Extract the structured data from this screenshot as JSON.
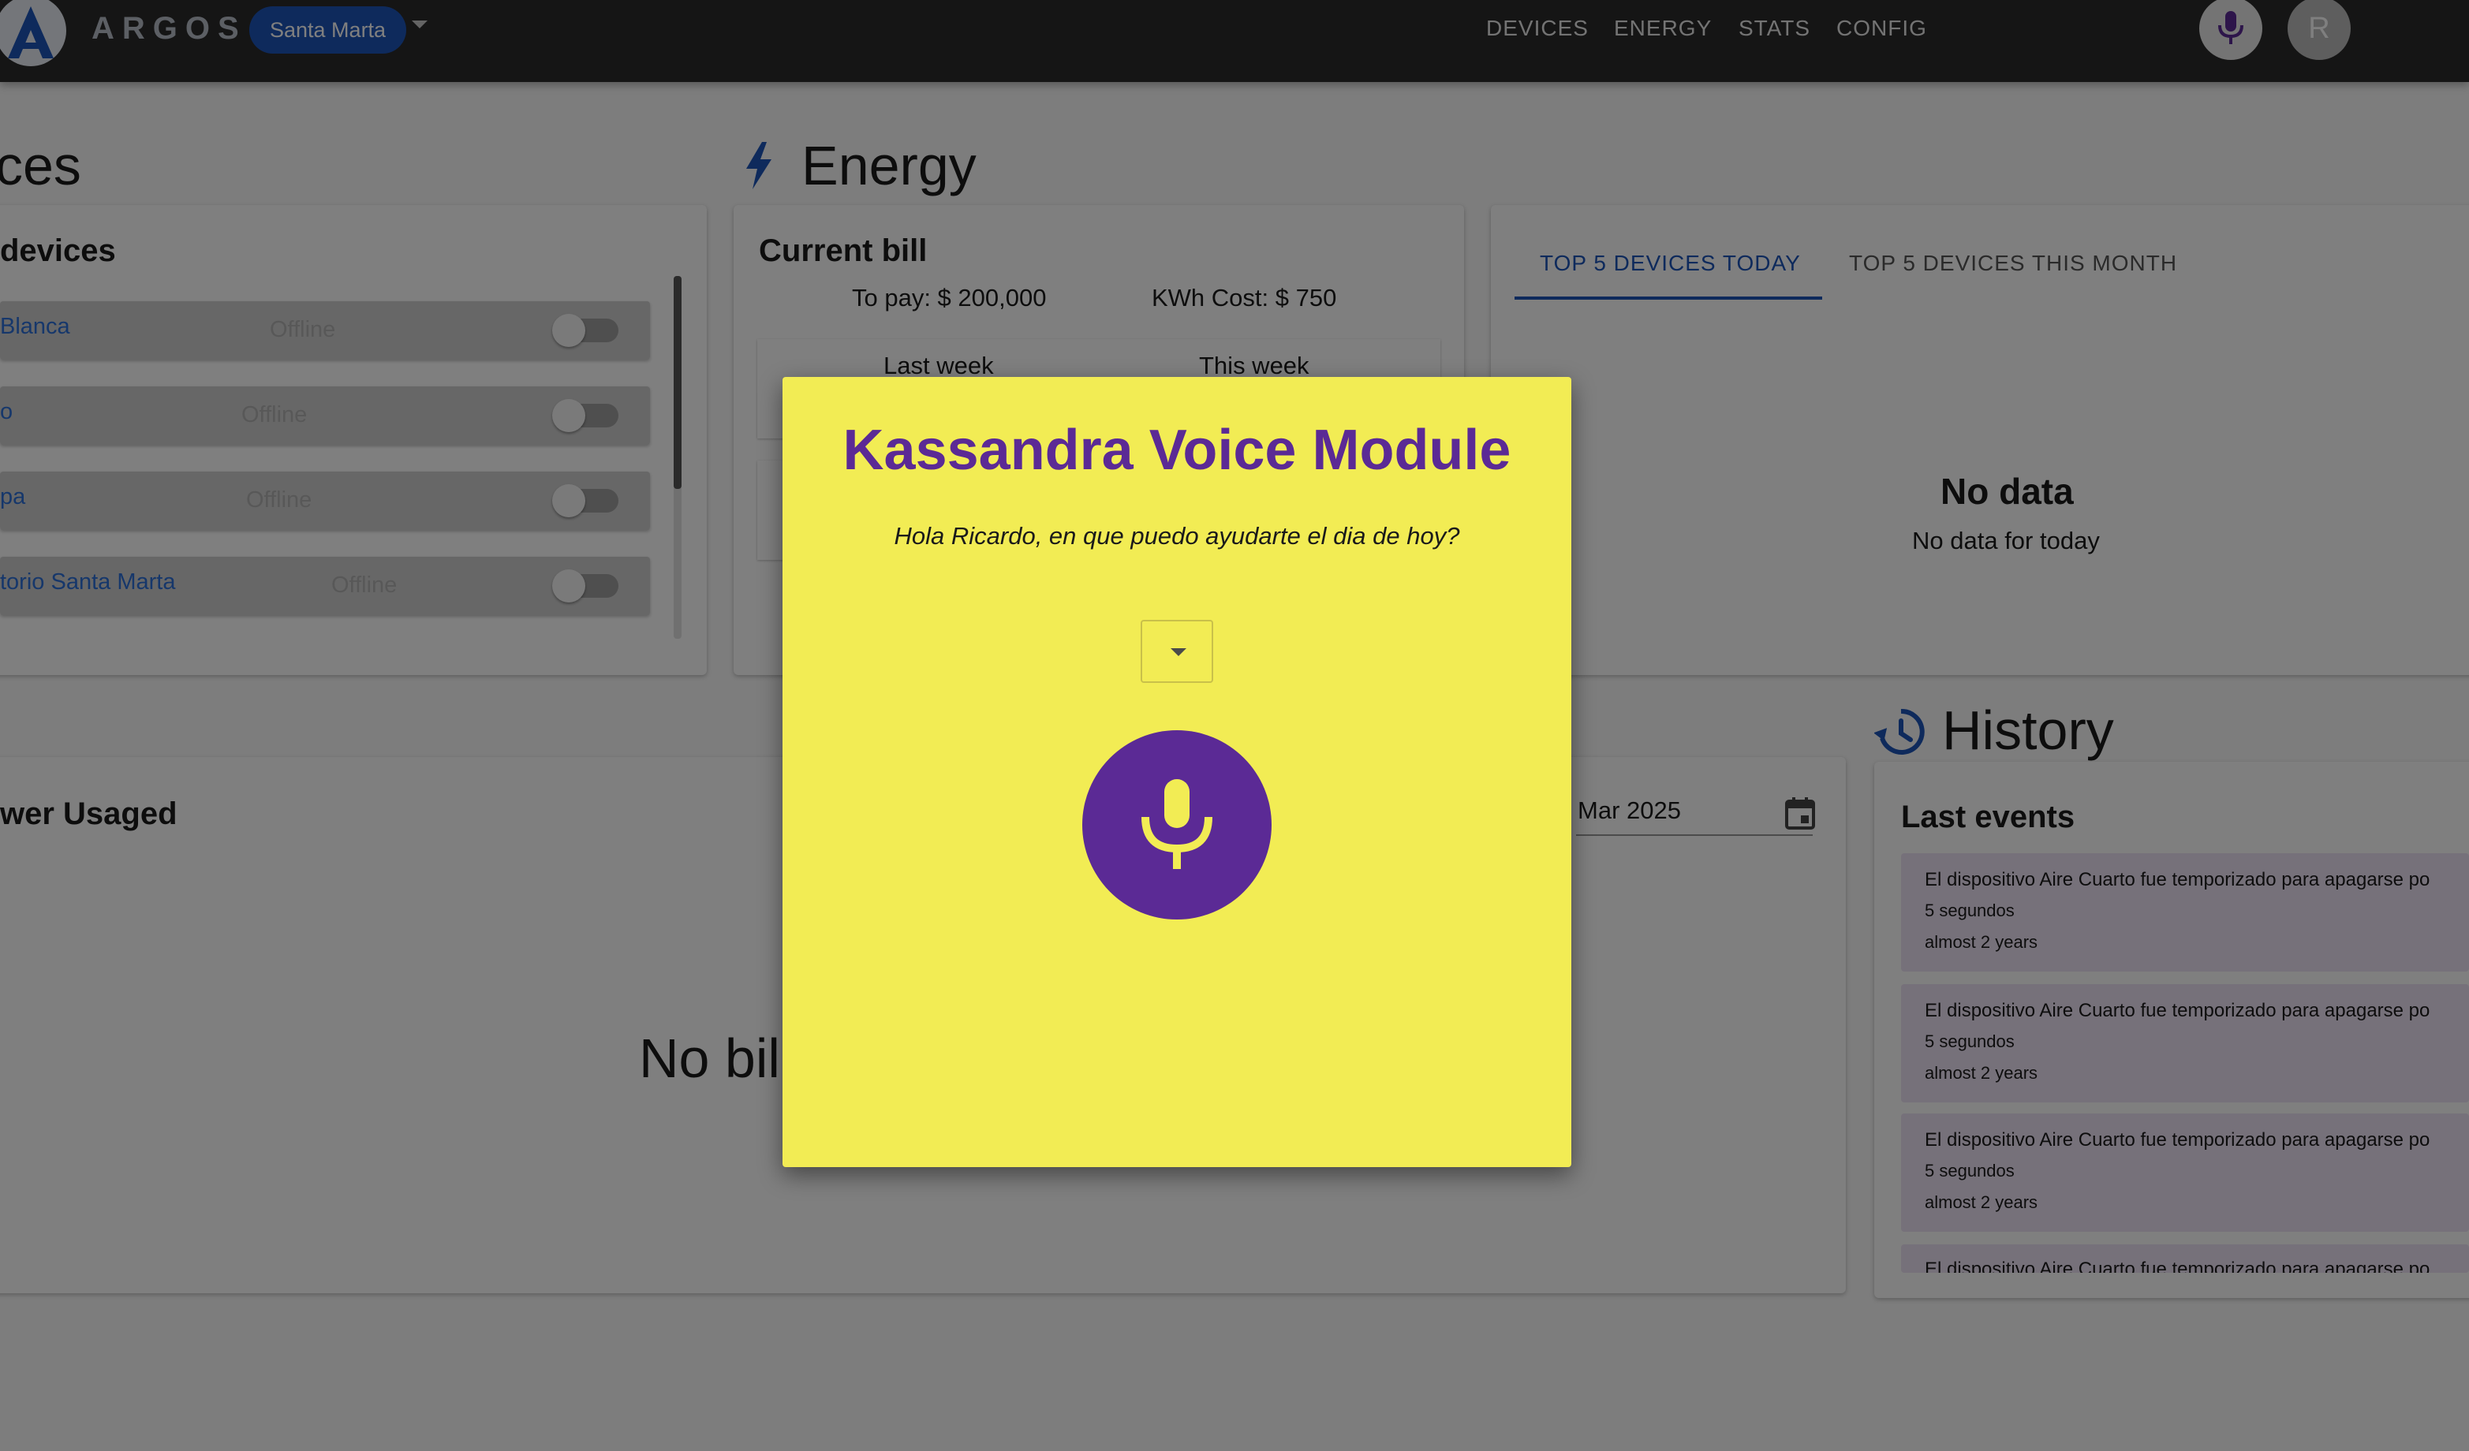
{
  "header": {
    "brand": "ARGOS",
    "location_chip": "Santa Marta",
    "nav": [
      "DEVICES",
      "ENERGY",
      "STATS",
      "CONFIG"
    ],
    "avatar_initial": "R"
  },
  "devices": {
    "title_partial": "ces",
    "card_title_partial": "devices",
    "rows": [
      {
        "name": "Blanca",
        "status": "Offline"
      },
      {
        "name": "o",
        "status": "Offline"
      },
      {
        "name": "pa",
        "status": "Offline"
      },
      {
        "name": "torio Santa Marta",
        "status": "Offline"
      }
    ]
  },
  "energy": {
    "title": "Energy",
    "card_title": "Current bill",
    "to_pay": "To pay: $ 200,000",
    "kwh_cost": "KWh Cost: $ 750",
    "last_week": "Last week",
    "this_week": "This week"
  },
  "top_devices": {
    "tabs": [
      "TOP 5 DEVICES TODAY",
      "TOP 5 DEVICES THIS MONTH"
    ],
    "no_data_title": "No data",
    "no_data_sub": "No data for today"
  },
  "power": {
    "title_partial": "wer Usaged",
    "date_value": "Mar 2025",
    "no_bill_partial": "No bil"
  },
  "history": {
    "title": "History",
    "card_title": "Last events",
    "events": [
      {
        "text": "El dispositivo Aire Cuarto fue temporizado para apagarse po",
        "line2": "5 segundos",
        "time": "almost 2 years"
      },
      {
        "text": "El dispositivo Aire Cuarto fue temporizado para apagarse po",
        "line2": "5 segundos",
        "time": "almost 2 years"
      },
      {
        "text": "El dispositivo Aire Cuarto fue temporizado para apagarse po",
        "line2": "5 segundos",
        "time": "almost 2 years"
      },
      {
        "text": "El dispositivo Aire Cuarto fue temporizado para apagarse po",
        "line2": "",
        "time": ""
      }
    ]
  },
  "modal": {
    "title": "Kassandra Voice Module",
    "greeting": "Hola Ricardo, en que puedo ayudarte el dia de hoy?",
    "mic_icon": "microphone-icon",
    "accent": "#5b2a95",
    "background": "#f2ec54"
  }
}
